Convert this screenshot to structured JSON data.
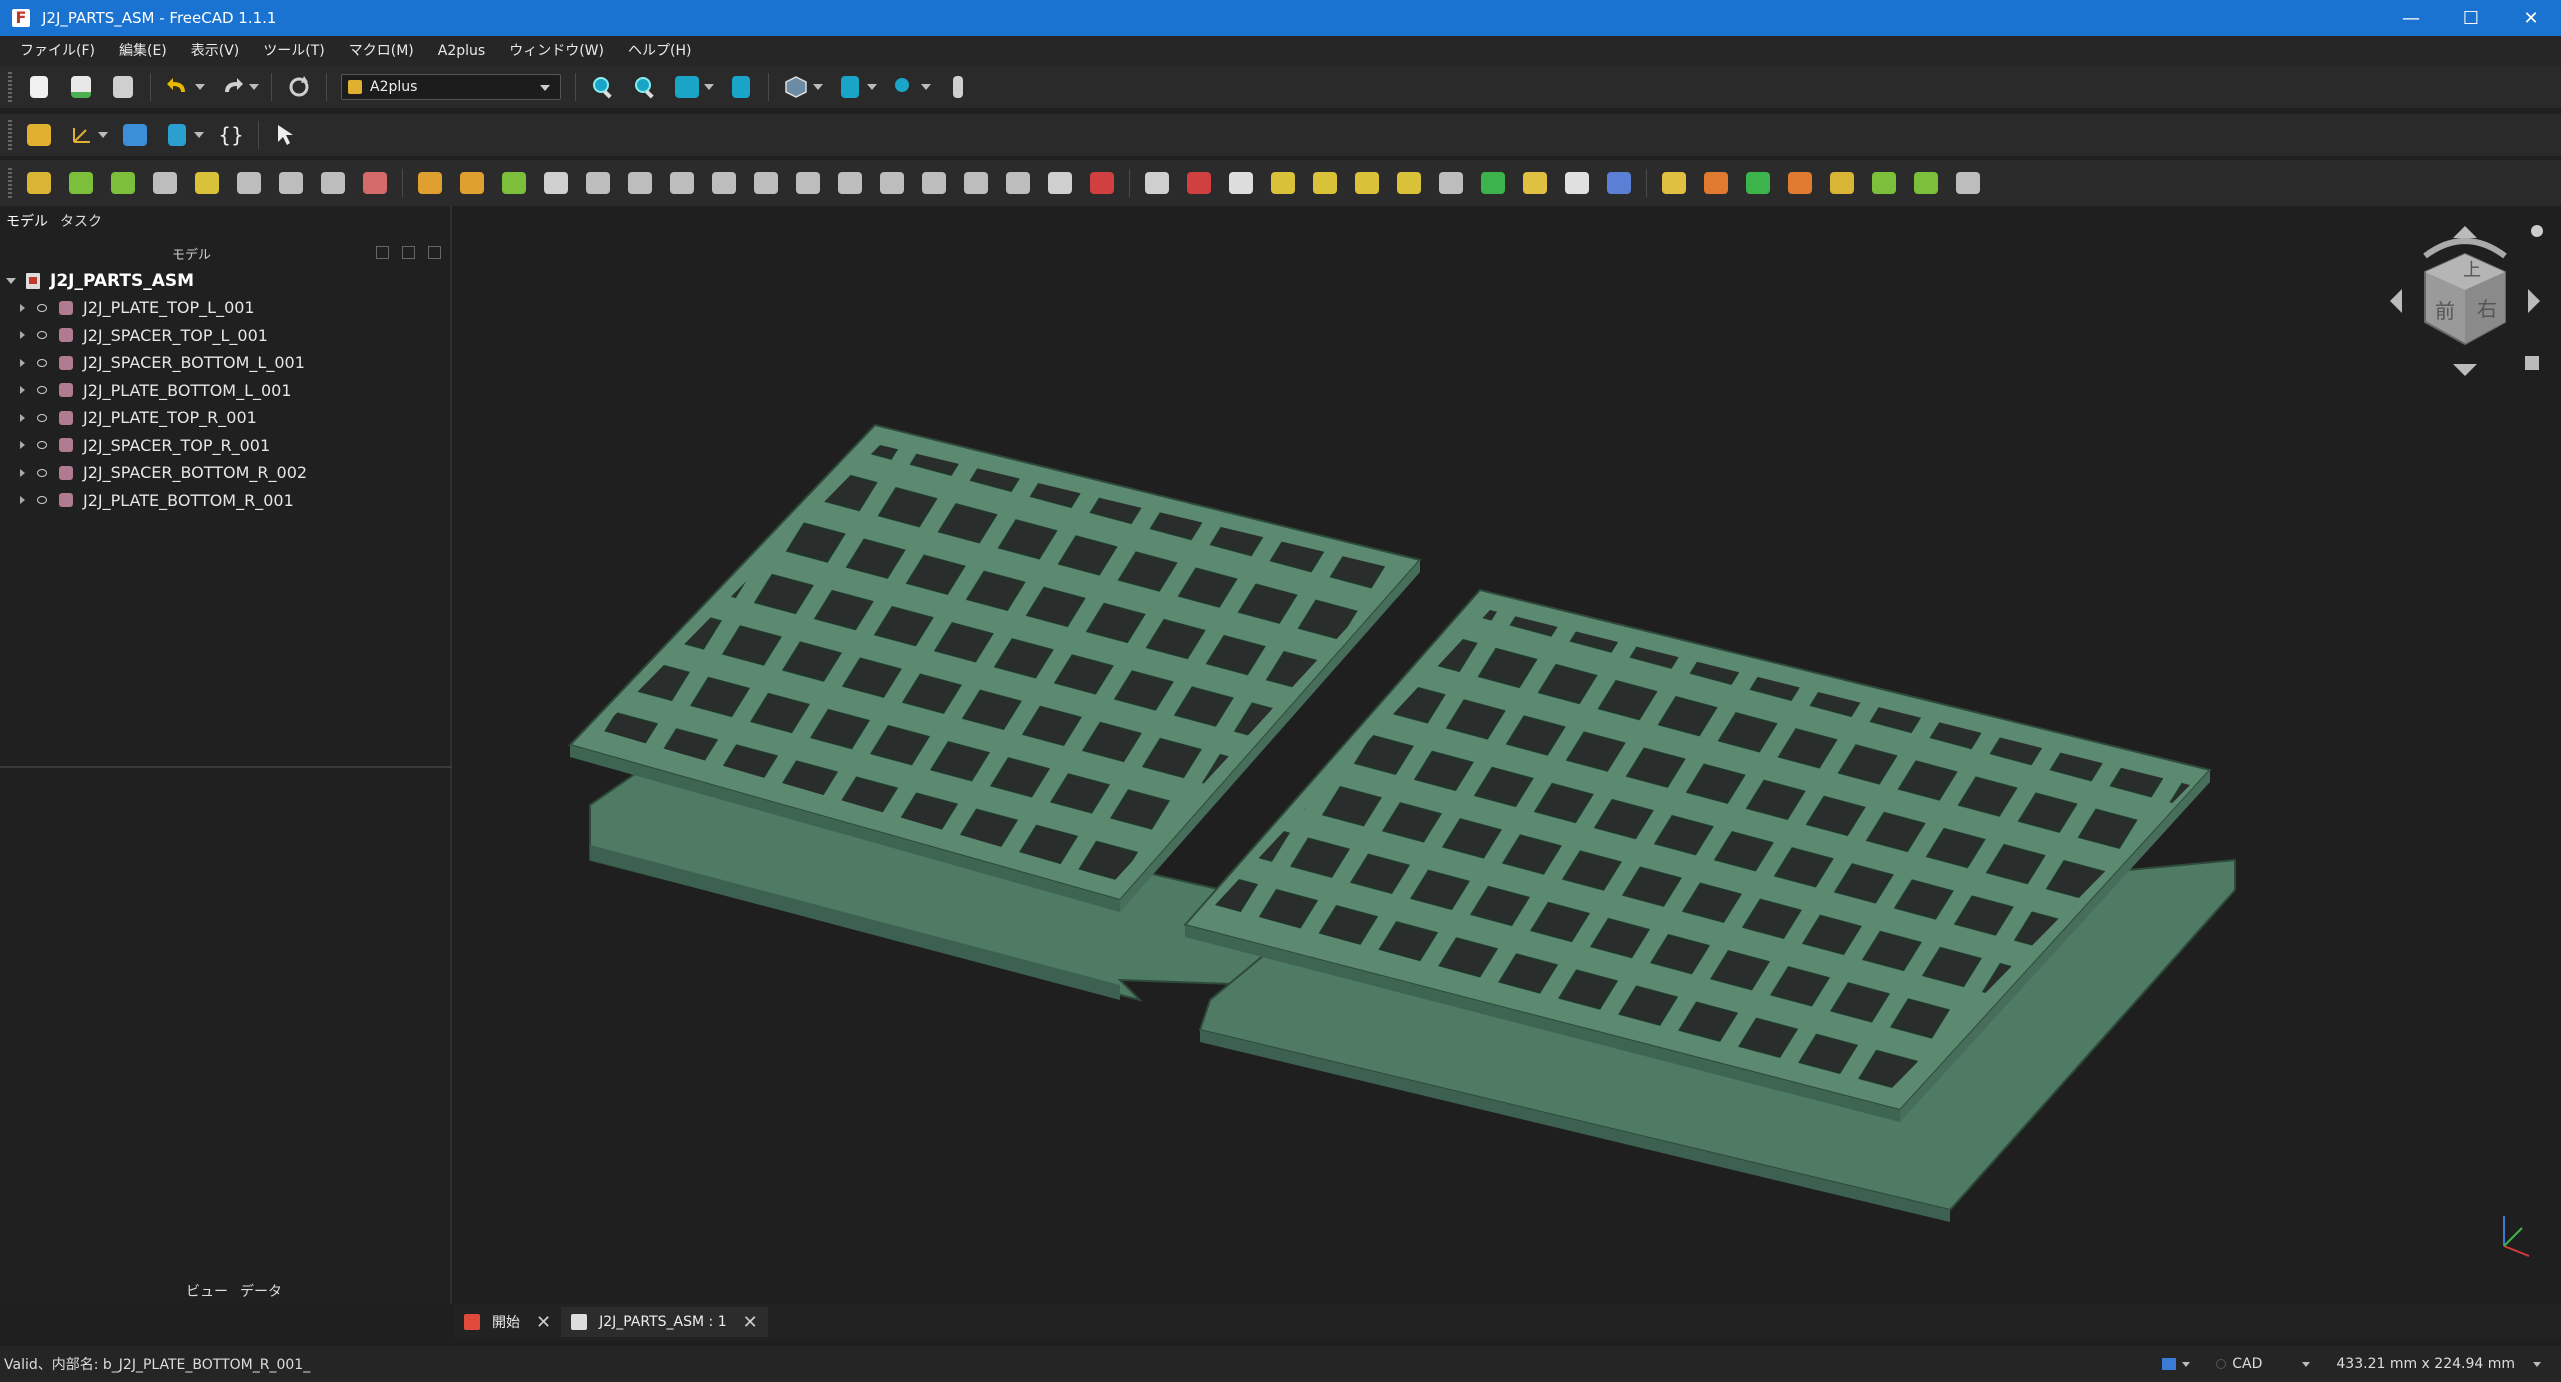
{
  "window": {
    "title": "J2J_PARTS_ASM - FreeCAD 1.1.1",
    "app_icon": "F",
    "minimize": "—",
    "maximize": "☐",
    "close": "✕"
  },
  "menu": [
    "ファイル(F)",
    "編集(E)",
    "表示(V)",
    "ツール(T)",
    "マクロ(M)",
    "A2plus",
    "ウィンドウ(W)",
    "ヘルプ(H)"
  ],
  "toolbar": {
    "workbench": "A2plus",
    "code_icon": "{}"
  },
  "panel": {
    "tabs": [
      "モデル",
      "タスク"
    ],
    "tree_header": "モデル",
    "root": "J2J_PARTS_ASM",
    "items": [
      "J2J_PLATE_TOP_L_001",
      "J2J_SPACER_TOP_L_001",
      "J2J_SPACER_BOTTOM_L_001",
      "J2J_PLATE_BOTTOM_L_001",
      "J2J_PLATE_TOP_R_001",
      "J2J_SPACER_TOP_R_001",
      "J2J_SPACER_BOTTOM_R_002",
      "J2J_PLATE_BOTTOM_R_001"
    ],
    "bottom_tabs": [
      "ビュー",
      "データ"
    ]
  },
  "navcube": {
    "top": "上",
    "front": "前",
    "right": "右"
  },
  "doc_tabs": [
    {
      "label": "開始",
      "close": "✕"
    },
    {
      "label": "J2J_PARTS_ASM : 1",
      "close": "✕"
    }
  ],
  "status": {
    "message": "Valid、内部名: b_J2J_PLATE_BOTTOM_R_001_",
    "nav_style": "CAD",
    "dimensions": "433.21 mm x 224.94 mm"
  },
  "colors": {
    "titlebar": "#1a73d1",
    "model": "#5b8a71",
    "model_edge": "#2e4a3a",
    "background": "#1f1f1f"
  }
}
